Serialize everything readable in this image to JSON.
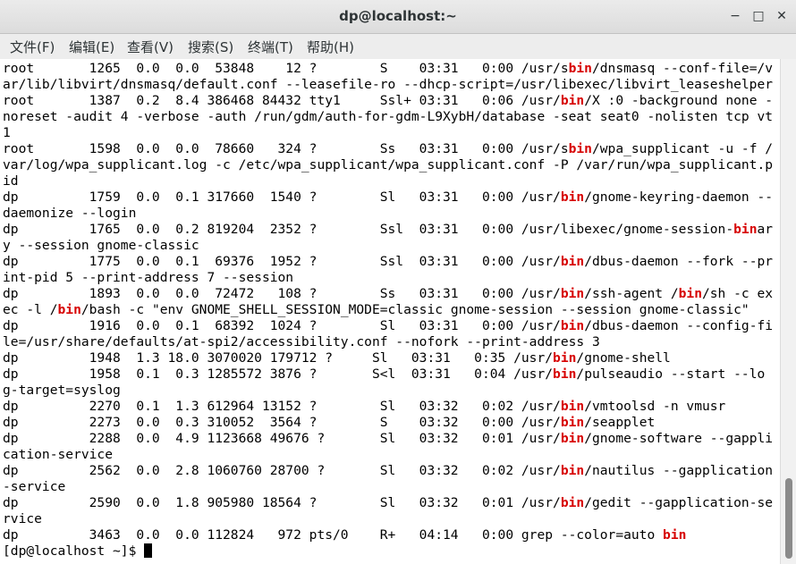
{
  "window": {
    "title": "dp@localhost:~"
  },
  "window_controls": {
    "minimize": "−",
    "maximize": "□",
    "close": "✕"
  },
  "menu": [
    "文件(F)",
    "编辑(E)",
    "查看(V)",
    "搜索(S)",
    "终端(T)",
    "帮助(H)"
  ],
  "scrollbar": {
    "thumb_start": 0.83,
    "thumb_end": 0.99
  },
  "terminal": {
    "highlight_word": "bin",
    "lines": [
      "root       1265  0.0  0.0  53848    12 ?        S    03:31   0:00 /usr/sbin/dnsmasq --conf-file=/v",
      "ar/lib/libvirt/dnsmasq/default.conf --leasefile-ro --dhcp-script=/usr/libexec/libvirt_leaseshelper",
      "root       1387  0.2  8.4 386468 84432 tty1     Ssl+ 03:31   0:06 /usr/bin/X :0 -background none -",
      "noreset -audit 4 -verbose -auth /run/gdm/auth-for-gdm-L9XybH/database -seat seat0 -nolisten tcp vt",
      "1",
      "root       1598  0.0  0.0  78660   324 ?        Ss   03:31   0:00 /usr/sbin/wpa_supplicant -u -f /",
      "var/log/wpa_supplicant.log -c /etc/wpa_supplicant/wpa_supplicant.conf -P /var/run/wpa_supplicant.p",
      "id",
      "dp         1759  0.0  0.1 317660  1540 ?        Sl   03:31   0:00 /usr/bin/gnome-keyring-daemon --",
      "daemonize --login",
      "dp         1765  0.0  0.2 819204  2352 ?        Ssl  03:31   0:00 /usr/libexec/gnome-session-binar",
      "y --session gnome-classic",
      "dp         1775  0.0  0.1  69376  1952 ?        Ssl  03:31   0:00 /usr/bin/dbus-daemon --fork --pr",
      "int-pid 5 --print-address 7 --session",
      "dp         1893  0.0  0.0  72472   108 ?        Ss   03:31   0:00 /usr/bin/ssh-agent /bin/sh -c ex",
      "ec -l /bin/bash -c \"env GNOME_SHELL_SESSION_MODE=classic gnome-session --session gnome-classic\"",
      "dp         1916  0.0  0.1  68392  1024 ?        Sl   03:31   0:00 /usr/bin/dbus-daemon --config-fi",
      "le=/usr/share/defaults/at-spi2/accessibility.conf --nofork --print-address 3",
      "dp         1948  1.3 18.0 3070020 179712 ?     Sl   03:31   0:35 /usr/bin/gnome-shell",
      "dp         1958  0.1  0.3 1285572 3876 ?       S<l  03:31   0:04 /usr/bin/pulseaudio --start --lo",
      "g-target=syslog",
      "dp         2270  0.1  1.3 612964 13152 ?        Sl   03:32   0:02 /usr/bin/vmtoolsd -n vmusr",
      "dp         2273  0.0  0.3 310052  3564 ?        S    03:32   0:00 /usr/bin/seapplet",
      "dp         2288  0.0  4.9 1123668 49676 ?       Sl   03:32   0:01 /usr/bin/gnome-software --gappli",
      "cation-service",
      "dp         2562  0.0  2.8 1060760 28700 ?       Sl   03:32   0:02 /usr/bin/nautilus --gapplication",
      "-service",
      "dp         2590  0.0  1.8 905980 18564 ?        Sl   03:32   0:01 /usr/bin/gedit --gapplication-se",
      "rvice",
      "dp         3463  0.0  0.0 112824   972 pts/0    R+   04:14   0:00 grep --color=auto bin"
    ],
    "prompt": "[dp@localhost ~]$ "
  }
}
